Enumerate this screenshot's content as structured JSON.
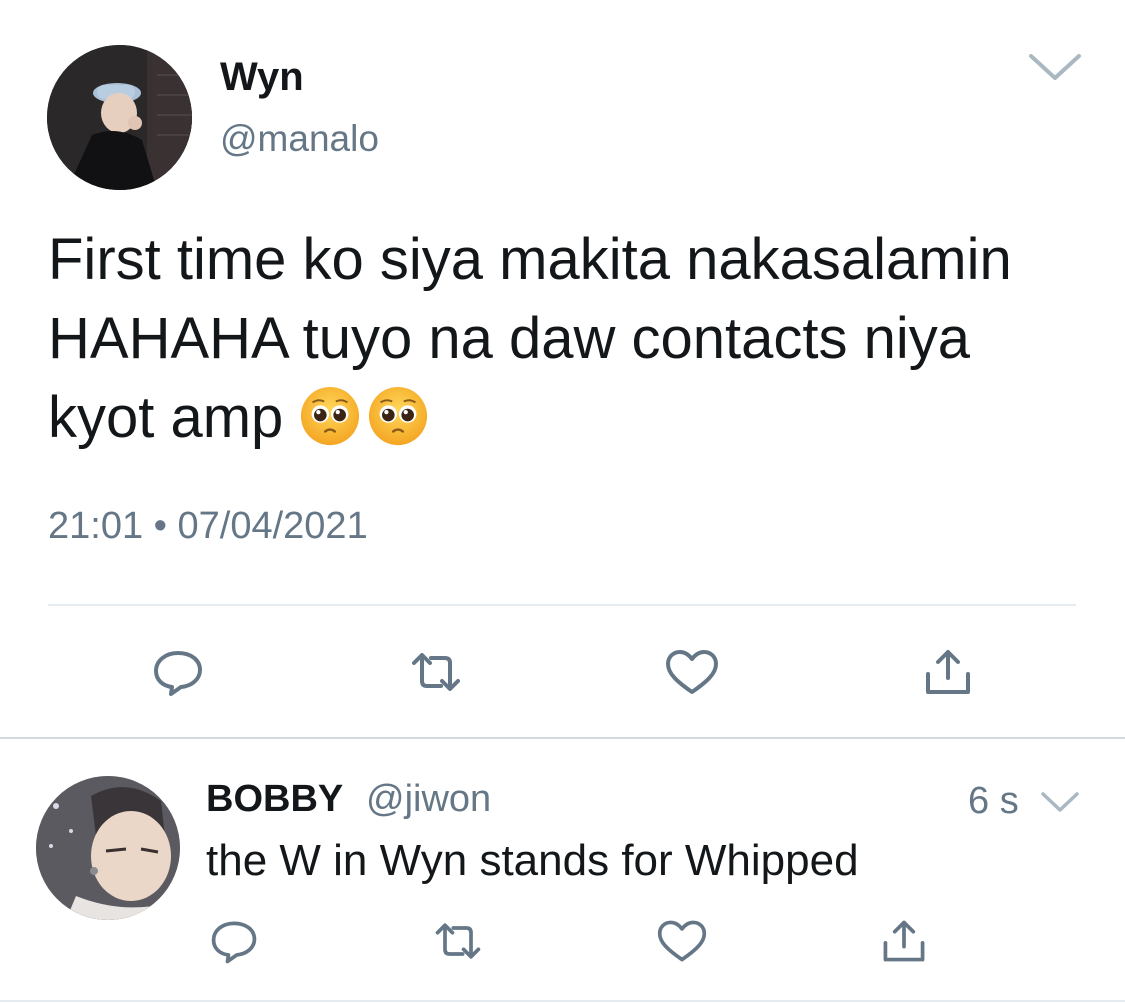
{
  "colors": {
    "text": "#14171a",
    "secondary": "#657786",
    "icon": "#657786",
    "divider": "#e6ecf0",
    "emoji": "#fbc531"
  },
  "tweet": {
    "author_name": "Wyn",
    "author_handle": "@manalo",
    "text_lines": [
      "First time ko siya makita nakasalamin",
      "HAHAHA tuyo na daw contacts niya",
      "kyot amp"
    ],
    "emojis": [
      "pleading-face-emoji",
      "pleading-face-emoji"
    ],
    "timestamp": "21:01 • 07/04/2021",
    "actions": [
      "reply-icon",
      "retweet-icon",
      "like-icon",
      "share-icon"
    ]
  },
  "reply": {
    "author_name": "BOBBY",
    "author_handle": "@jiwon",
    "time_ago": "6 s",
    "text": "the W in Wyn stands for Whipped",
    "actions": [
      "reply-icon",
      "retweet-icon",
      "like-icon",
      "share-icon"
    ]
  }
}
